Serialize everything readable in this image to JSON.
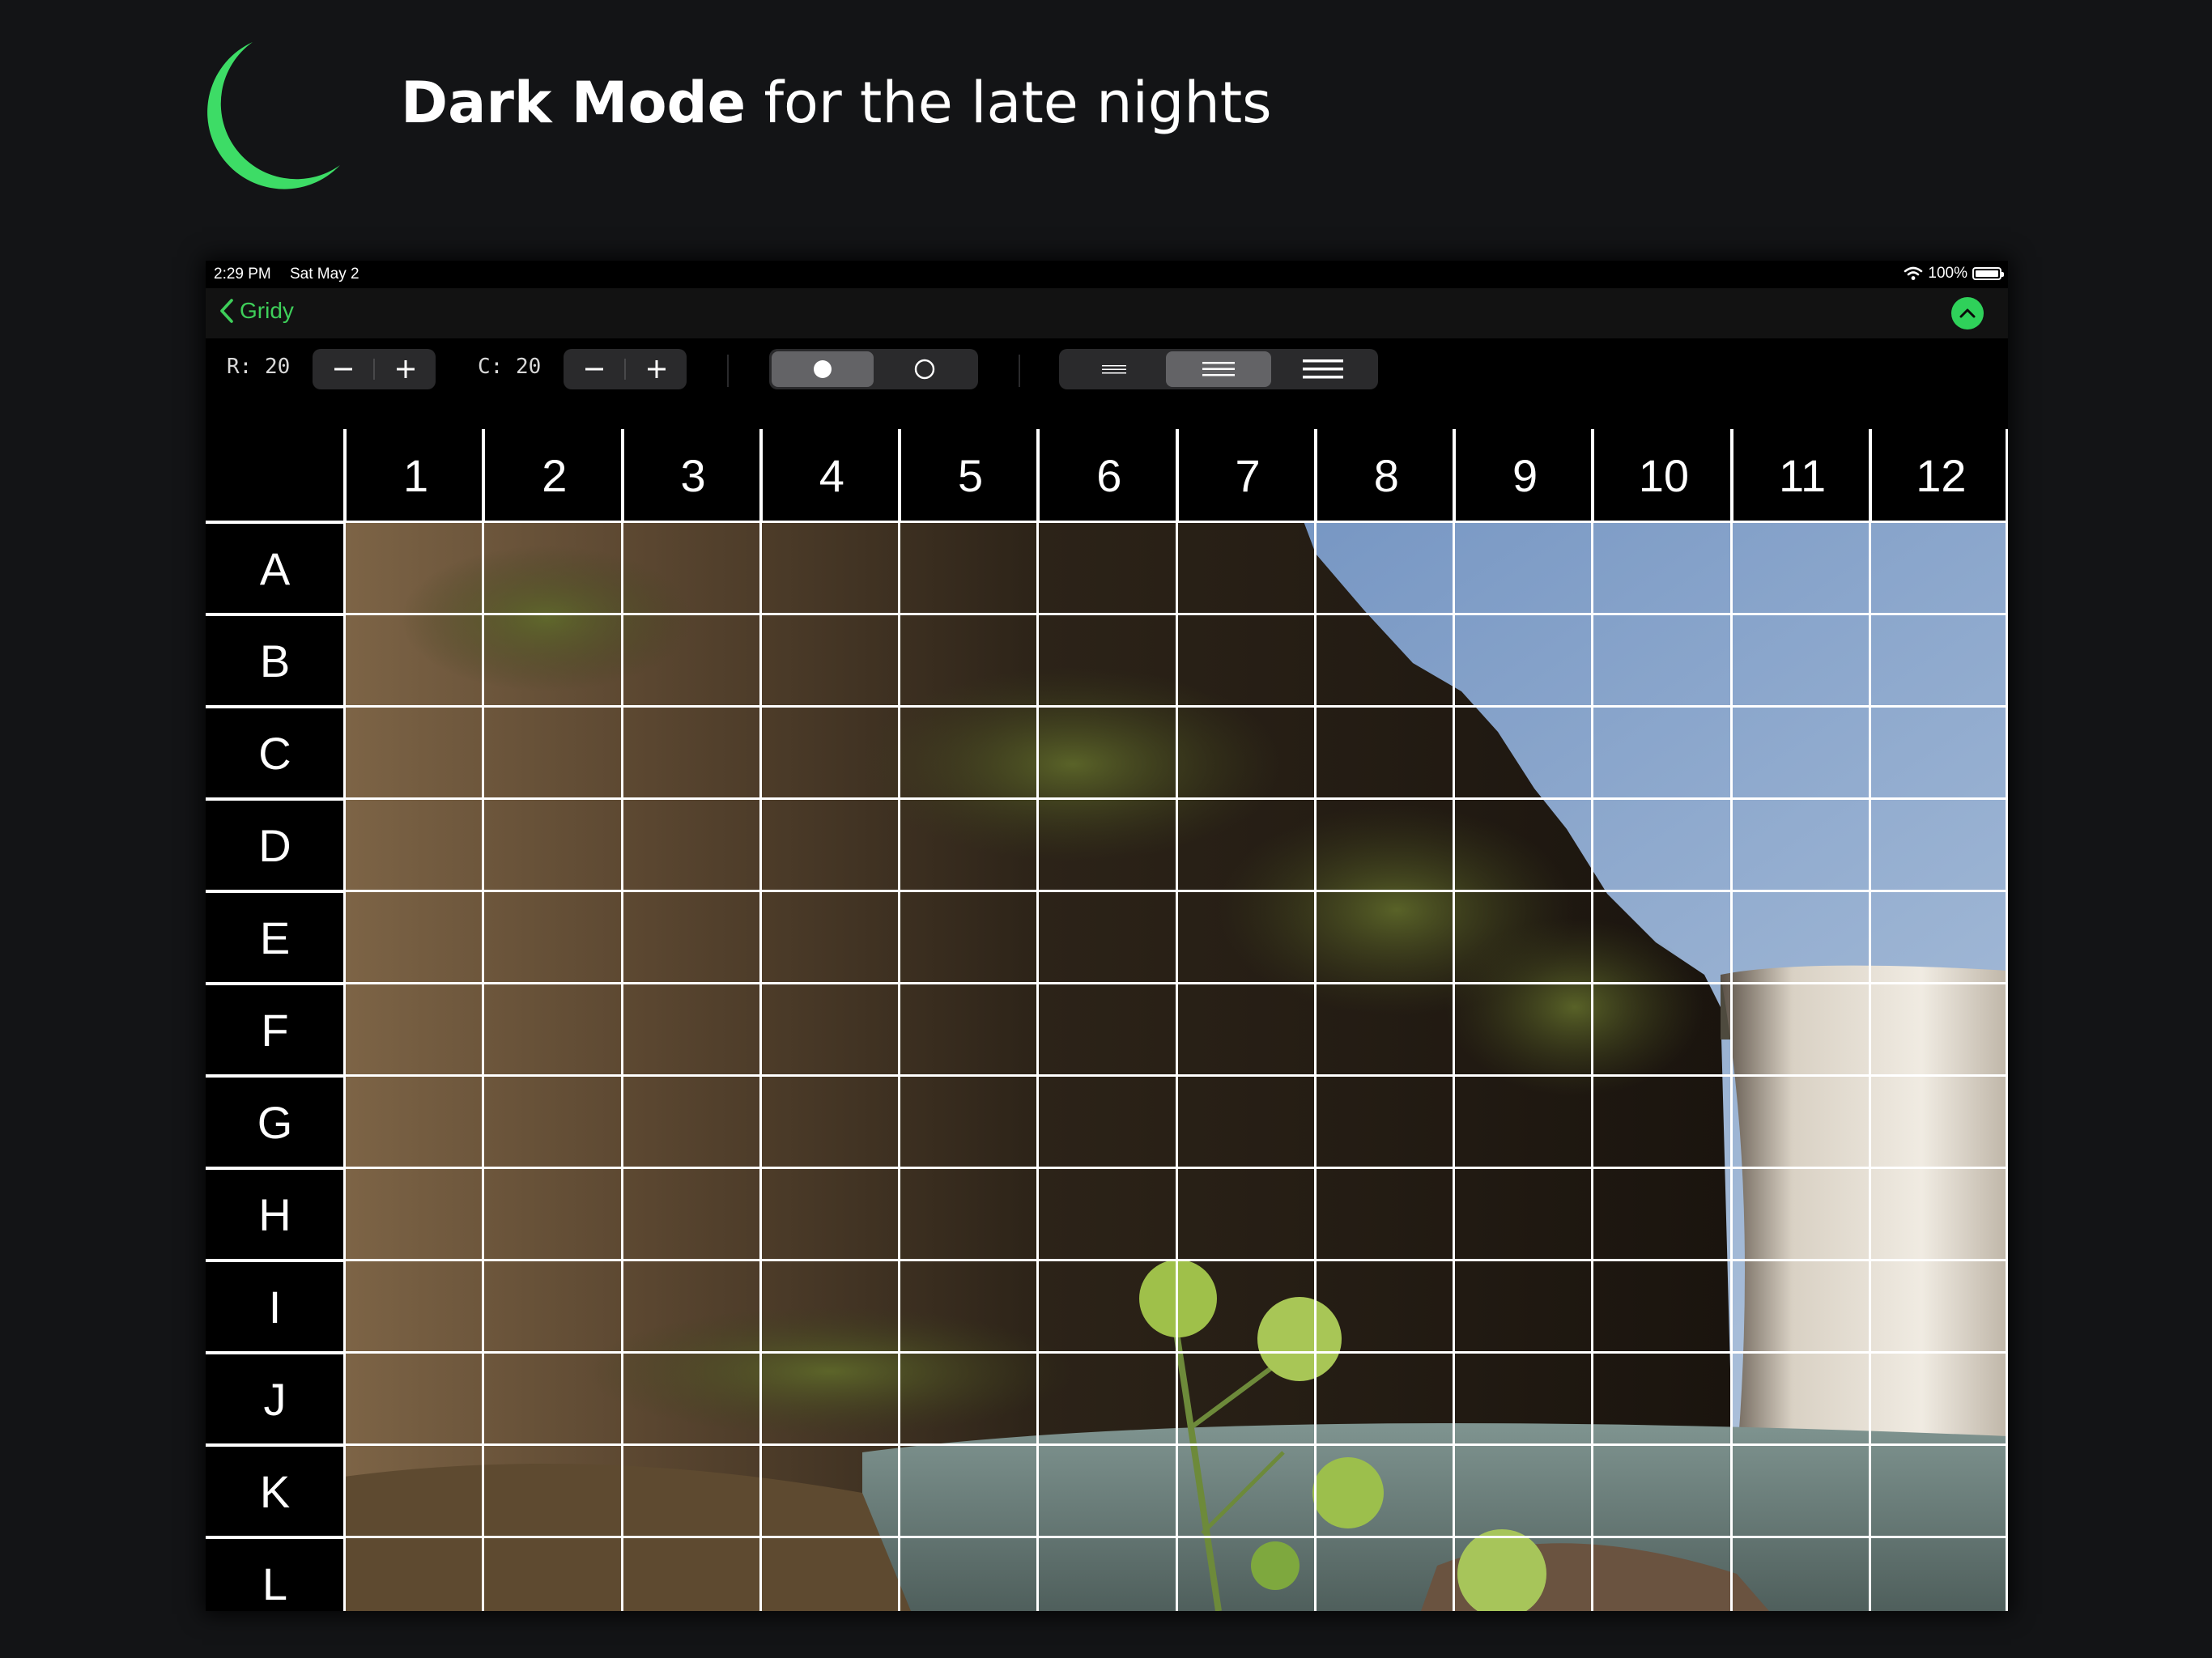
{
  "hero": {
    "title_bold": "Dark Mode",
    "title_rest": " for the late nights",
    "icon": "moon-icon",
    "accent": "#3ddc66"
  },
  "status_bar": {
    "time": "2:29 PM",
    "date": "Sat May 2",
    "battery": "100%"
  },
  "nav": {
    "back_label": "Gridy",
    "accent": "#2fd15a"
  },
  "toolbar": {
    "rows_label": "R: 20",
    "cols_label": "C: 20",
    "minus": "−",
    "plus": "+",
    "style_selected": "filled-circle",
    "thickness_selected": "medium"
  },
  "grid": {
    "columns": [
      "1",
      "2",
      "3",
      "4",
      "5",
      "6",
      "7",
      "8",
      "9",
      "10",
      "11",
      "12"
    ],
    "rows": [
      "A",
      "B",
      "C",
      "D",
      "E",
      "F",
      "G",
      "H",
      "I",
      "J",
      "K",
      "L"
    ]
  }
}
